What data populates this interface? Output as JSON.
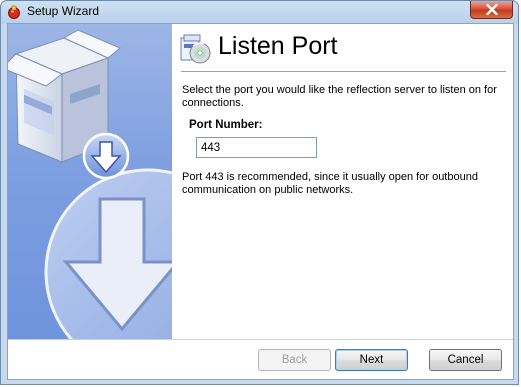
{
  "window": {
    "title": "Setup Wizard"
  },
  "page": {
    "title": "Listen Port",
    "description": "Select the port you would like the reflection server to listen on for connections.",
    "port_label": "Port Number:",
    "port_value": "443",
    "note": "Port 443 is recommended, since it usually open for outbound communication on public networks."
  },
  "buttons": {
    "back": "Back",
    "next": "Next",
    "cancel": "Cancel"
  },
  "colors": {
    "side_panel": "#7e9fe0",
    "close_button": "#c43a23"
  }
}
